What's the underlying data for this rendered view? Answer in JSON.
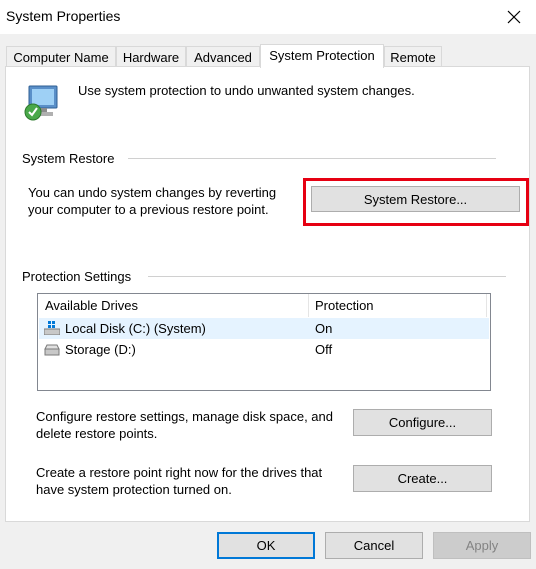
{
  "window": {
    "title": "System Properties"
  },
  "tabs": [
    {
      "label": "Computer Name",
      "active": false
    },
    {
      "label": "Hardware",
      "active": false
    },
    {
      "label": "Advanced",
      "active": false
    },
    {
      "label": "System Protection",
      "active": true
    },
    {
      "label": "Remote",
      "active": false
    }
  ],
  "intro": {
    "text": "Use system protection to undo unwanted system changes."
  },
  "system_restore": {
    "heading": "System Restore",
    "line1": "You can undo system changes by reverting",
    "line2": "your computer to a previous restore point.",
    "button": "System Restore..."
  },
  "protection": {
    "heading": "Protection Settings",
    "columns": {
      "drives": "Available Drives",
      "protection": "Protection"
    },
    "rows": [
      {
        "name": "Local Disk (C:) (System)",
        "protection": "On",
        "selected": true
      },
      {
        "name": "Storage (D:)",
        "protection": "Off",
        "selected": false
      }
    ],
    "configure_line1": "Configure restore settings, manage disk space, and",
    "configure_line2": "delete restore points.",
    "configure_button": "Configure...",
    "create_line1": "Create a restore point right now for the drives that",
    "create_line2": "have system protection turned on.",
    "create_button": "Create..."
  },
  "footer": {
    "ok": "OK",
    "cancel": "Cancel",
    "apply": "Apply"
  },
  "colors": {
    "highlight": "#e60012",
    "default_button_border": "#0078d7",
    "selected_row": "#e5f3ff"
  }
}
